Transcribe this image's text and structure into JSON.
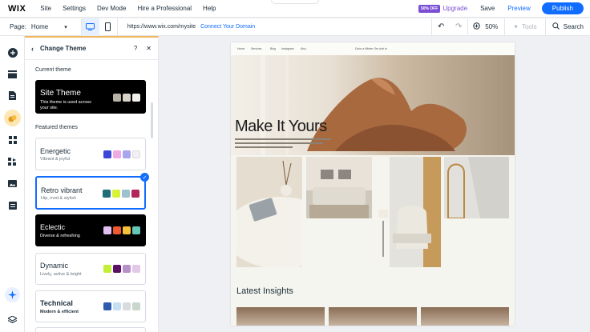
{
  "topbar": {
    "logo": "WIX",
    "menu": [
      "Site",
      "Settings",
      "Dev Mode",
      "Hire a Professional",
      "Help"
    ],
    "discount_badge": "50% OFF",
    "upgrade": "Upgrade",
    "save": "Save",
    "preview": "Preview",
    "publish": "Publish"
  },
  "addressbar": {
    "page_label": "Page:",
    "page_value": "Home",
    "url": "https://www.wix.com/mysite",
    "connect": "Connect Your Domain",
    "zoom": "50%",
    "tools": "Tools",
    "search": "Search"
  },
  "panel": {
    "title": "Change Theme",
    "current_label": "Current theme",
    "site_theme": {
      "name": "Site Theme",
      "desc": "This theme is used across your site.",
      "swatches": [
        "#b9b3a6",
        "#d8d3c9",
        "#f2f1ec"
      ]
    },
    "featured_label": "Featured themes",
    "themes": [
      {
        "name": "Energetic",
        "desc": "Vibrant & joyful",
        "swatches": [
          "#3b48d6",
          "#f0a8e6",
          "#a7a6ee",
          "#f4eef7"
        ]
      },
      {
        "name": "Retro vibrant",
        "desc": "Hip, mod & stylish",
        "swatches": [
          "#1f6e7a",
          "#d8f23a",
          "#9cc1cf",
          "#b2265b"
        ]
      },
      {
        "name": "Eclectic",
        "desc": "Diverse & refreshing",
        "swatches": [
          "#e2bff2",
          "#f0592d",
          "#f7c23a",
          "#64c7b8"
        ]
      },
      {
        "name": "Dynamic",
        "desc": "Lively, active & bright",
        "swatches": [
          "#c3ef3a",
          "#5a1165",
          "#b790c8",
          "#e3c9e8"
        ]
      },
      {
        "name": "Technical",
        "desc": "Modern & efficient",
        "swatches": [
          "#2e5bab",
          "#c5e0f3",
          "#d8dcdc",
          "#c9d7cc"
        ]
      }
    ]
  },
  "site": {
    "nav": [
      "Home",
      "Services",
      "Blog",
      "Instagram",
      "Also"
    ],
    "nav_center": "Dolor a Winter Ore dort in",
    "hero_title": "Make It Yours",
    "latest": "Latest Insights"
  }
}
